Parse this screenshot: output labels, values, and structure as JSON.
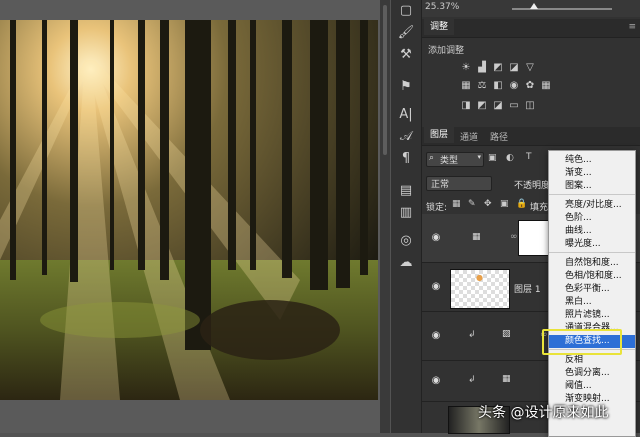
{
  "zoom": "25.37%",
  "adjustments_panel": {
    "tab": "调整",
    "add_adjustment": "添加调整"
  },
  "layers_panel": {
    "tabs": [
      "图层",
      "通道",
      "路径"
    ],
    "filter_kind": "类型",
    "blend_mode": "正常",
    "opacity_label": "不透明度",
    "lock_label": "锁定:",
    "fill_label": "填充",
    "layers": [
      {
        "name": "图层 1"
      }
    ]
  },
  "menu": {
    "items": [
      {
        "label": "纯色..."
      },
      {
        "label": "渐变..."
      },
      {
        "label": "图案..."
      },
      {
        "label": "亮度/对比度..."
      },
      {
        "label": "色阶..."
      },
      {
        "label": "曲线..."
      },
      {
        "label": "曝光度..."
      },
      {
        "label": "自然饱和度..."
      },
      {
        "label": "色相/饱和度..."
      },
      {
        "label": "色彩平衡..."
      },
      {
        "label": "黑白..."
      },
      {
        "label": "照片滤镜..."
      },
      {
        "label": "通道混合器..."
      },
      {
        "label": "颜色查找..."
      },
      {
        "label": "反相"
      },
      {
        "label": "色调分离..."
      },
      {
        "label": "阈值..."
      },
      {
        "label": "渐变映射..."
      }
    ],
    "selected": "颜色查找..."
  },
  "watermark": "头条 @设计原来如此",
  "colors": {
    "accent": "#2d6fd6",
    "highlight": "#e9e33a"
  }
}
